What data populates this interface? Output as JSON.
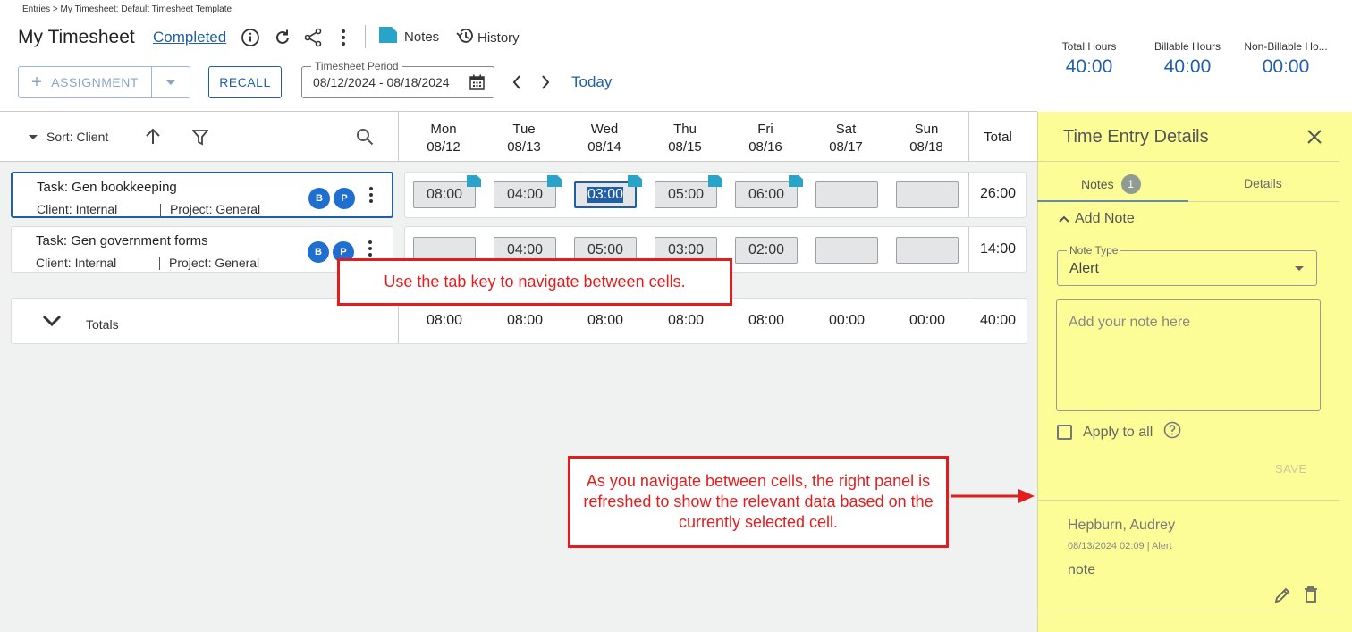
{
  "header": {
    "breadcrumb": "Entries > My Timesheet: Default Timesheet Template",
    "title": "My Timesheet",
    "status": "Completed",
    "notes_label": "Notes",
    "history_label": "History"
  },
  "toolbar": {
    "assignment_label": "ASSIGNMENT",
    "recall_label": "RECALL",
    "period_legend": "Timesheet Period",
    "period_value": "08/12/2024 - 08/18/2024",
    "today_label": "Today"
  },
  "summary": {
    "total_label": "Total Hours",
    "total_value": "40:00",
    "billable_label": "Billable Hours",
    "billable_value": "40:00",
    "nonbillable_label": "Non-Billable Ho...",
    "nonbillable_value": "00:00"
  },
  "grid": {
    "sort_label": "Sort: Client",
    "days": [
      {
        "dow": "Mon",
        "date": "08/12"
      },
      {
        "dow": "Tue",
        "date": "08/13"
      },
      {
        "dow": "Wed",
        "date": "08/14"
      },
      {
        "dow": "Thu",
        "date": "08/15"
      },
      {
        "dow": "Fri",
        "date": "08/16"
      },
      {
        "dow": "Sat",
        "date": "08/17"
      },
      {
        "dow": "Sun",
        "date": "08/18"
      }
    ],
    "total_header": "Total",
    "rows": [
      {
        "task": "Task: Gen bookkeeping",
        "client": "Client: Internal",
        "project": "Project: General",
        "badges": [
          "B",
          "P"
        ],
        "cells": [
          "08:00",
          "04:00",
          "03:00",
          "05:00",
          "06:00",
          "",
          ""
        ],
        "total": "26:00"
      },
      {
        "task": "Task: Gen government forms",
        "client": "Client: Internal",
        "project": "Project: General",
        "badges": [
          "B",
          "P"
        ],
        "cells": [
          "",
          "04:00",
          "05:00",
          "03:00",
          "02:00",
          "",
          ""
        ],
        "total": "14:00"
      }
    ],
    "totals_label": "Totals",
    "totals": [
      "08:00",
      "08:00",
      "08:00",
      "08:00",
      "08:00",
      "00:00",
      "00:00"
    ],
    "grand_total": "40:00"
  },
  "callouts": {
    "tab_hint": "Use the tab key to navigate between cells.",
    "panel_hint": "As you navigate between cells, the right panel is refreshed to show the relevant data based on the currently selected cell."
  },
  "panel": {
    "title": "Time Entry Details",
    "tab_notes": "Notes",
    "tab_notes_count": "1",
    "tab_details": "Details",
    "add_note": "Add Note",
    "note_type_legend": "Note Type",
    "note_type_value": "Alert",
    "note_placeholder": "Add your note here",
    "apply_all": "Apply to all",
    "save_label": "SAVE",
    "note": {
      "author": "Hepburn, Audrey",
      "meta": "08/13/2024 02:09 | Alert",
      "text": "note"
    }
  },
  "colors": {
    "accent": "#1f5fa8",
    "panel_bg": "#fdfd98",
    "callout_red": "#e31d1d"
  }
}
